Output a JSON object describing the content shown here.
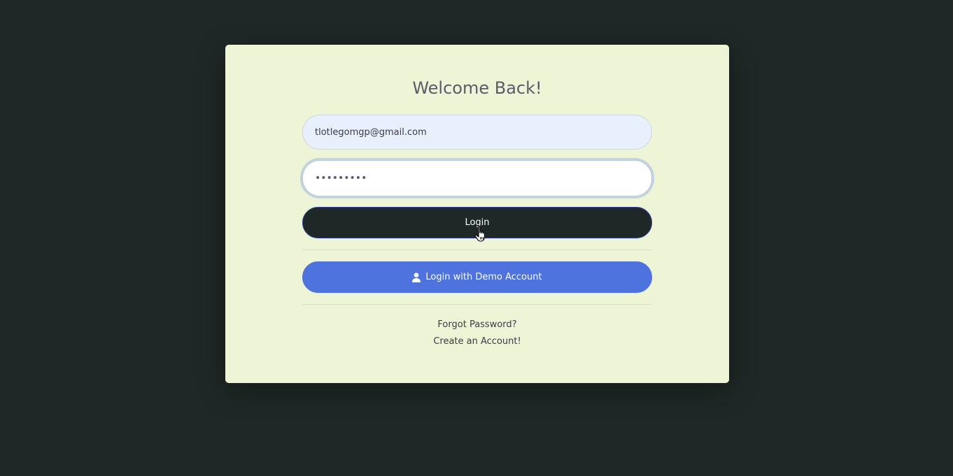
{
  "login_form": {
    "title": "Welcome Back!",
    "email_value": "tlotlegomgp@gmail.com",
    "password_value": "•••••••••",
    "login_label": "Login",
    "demo_label": "Login with Demo Account",
    "demo_icon": "user-icon",
    "forgot_password": "Forgot Password?",
    "create_account": "Create an Account!"
  },
  "colors": {
    "background": "#1f2826",
    "card": "#eef4d6",
    "login_button": "#1f2826",
    "demo_button": "#4e73df",
    "email_field": "#e8f0fe"
  }
}
